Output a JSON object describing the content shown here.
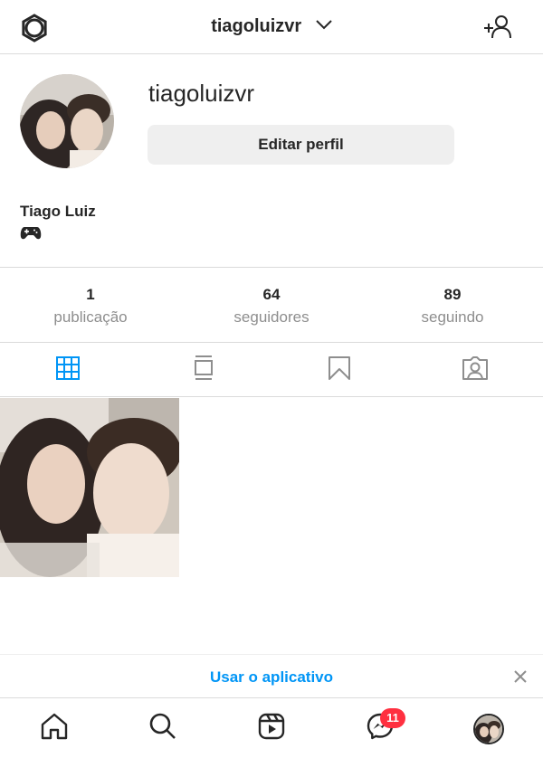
{
  "header": {
    "username": "tiagoluizvr",
    "icons": {
      "settings": "gear-icon",
      "switch_account": "chevron-down-icon",
      "discover_people": "add-user-icon"
    }
  },
  "profile": {
    "username": "tiagoluizvr",
    "edit_button": "Editar perfil",
    "full_name": "Tiago Luiz",
    "bio_icon": "game-controller-icon"
  },
  "stats": [
    {
      "value": "1",
      "label": "publicação"
    },
    {
      "value": "64",
      "label": "seguidores"
    },
    {
      "value": "89",
      "label": "seguindo"
    }
  ],
  "tabs": [
    {
      "name": "posts-grid",
      "icon": "grid-icon",
      "active": true
    },
    {
      "name": "feed",
      "icon": "feed-icon",
      "active": false
    },
    {
      "name": "saved",
      "icon": "bookmark-icon",
      "active": false
    },
    {
      "name": "tagged",
      "icon": "tagged-icon",
      "active": false
    }
  ],
  "posts_count": 1,
  "app_banner": {
    "label": "Usar o aplicativo"
  },
  "bottom_nav": {
    "items": [
      "home-icon",
      "search-icon",
      "reels-icon",
      "messenger-icon",
      "profile-avatar"
    ],
    "messenger_badge": "11"
  },
  "colors": {
    "accent": "#0095f6",
    "badge": "#ff3040",
    "text": "#262626",
    "muted": "#8e8e8e",
    "border": "#dbdbdb"
  }
}
